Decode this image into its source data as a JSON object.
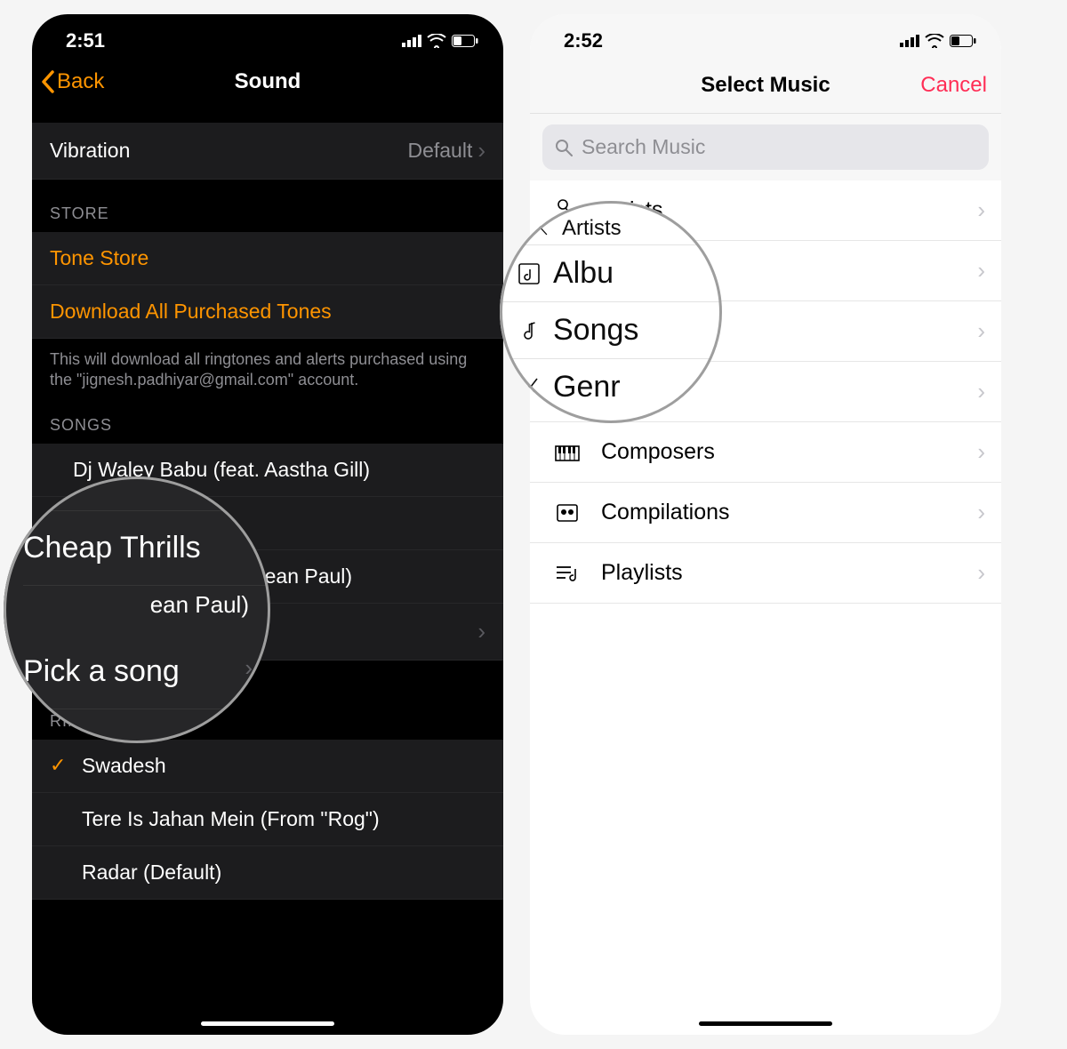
{
  "left": {
    "status": {
      "time": "2:51"
    },
    "nav": {
      "back": "Back",
      "title": "Sound"
    },
    "vibration": {
      "label": "Vibration",
      "value": "Default"
    },
    "store": {
      "header": "STORE",
      "tone_store": "Tone Store",
      "download_all": "Download All Purchased Tones",
      "note": "This will download all ringtones and alerts purchased using the \"jignesh.padhiyar@gmail.com\" account."
    },
    "songs": {
      "header": "SONGS",
      "items": [
        "Dj Waley Babu (feat. Aastha Gill)",
        "Cheap Thrills",
        "Cheap Thrills (feat. Sean Paul)"
      ],
      "pick": "Pick a song"
    },
    "ringtones": {
      "header": "RINGTONES",
      "items": [
        {
          "label": "Swadesh",
          "checked": true
        },
        {
          "label": "Tere Is Jahan Mein (From \"Rog\")",
          "checked": false
        },
        {
          "label": "Radar (Default)",
          "checked": false
        }
      ]
    },
    "callout": {
      "row1": "Cheap Thrills",
      "sub": "ean Paul)",
      "row2": "Pick a song"
    }
  },
  "right": {
    "status": {
      "time": "2:52"
    },
    "nav": {
      "title": "Select Music",
      "cancel": "Cancel"
    },
    "search": {
      "placeholder": "Search Music"
    },
    "categories": [
      {
        "icon": "mic",
        "label": "Artists"
      },
      {
        "icon": "album",
        "label": "Albums"
      },
      {
        "icon": "note",
        "label": "Songs"
      },
      {
        "icon": "guitar",
        "label": "Genres"
      },
      {
        "icon": "keyboard",
        "label": "Composers"
      },
      {
        "icon": "person-card",
        "label": "Compilations"
      },
      {
        "icon": "playlist",
        "label": "Playlists"
      }
    ],
    "callout": {
      "top": "Artists",
      "mid": "Albu",
      "main": "Songs",
      "bot": "Genr"
    }
  }
}
